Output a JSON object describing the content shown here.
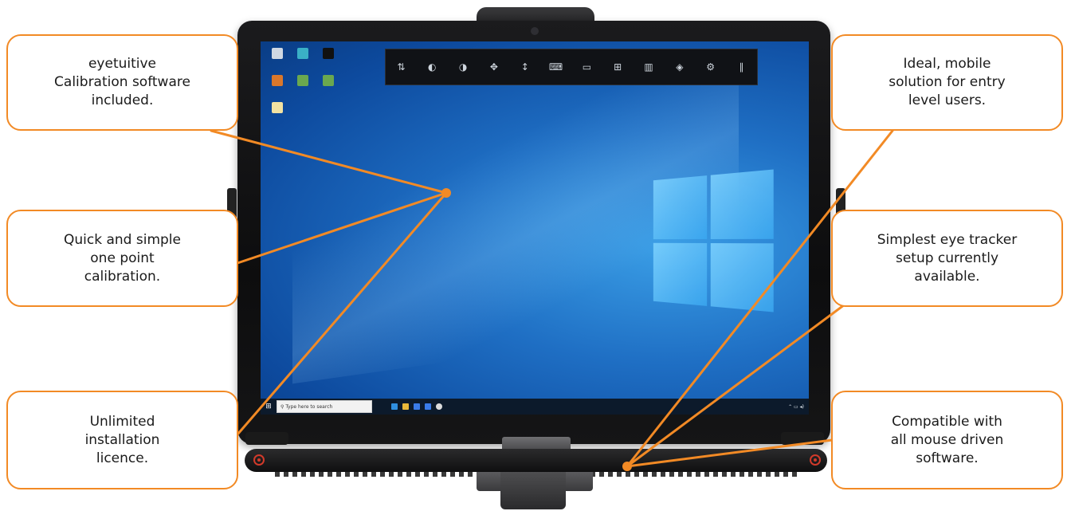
{
  "callouts": {
    "tl": "eyetuitive\nCalibration software\nincluded.",
    "ml": "Quick and simple\none point\ncalibration.",
    "bl": "Unlimited\ninstallation\nlicence.",
    "tr": "Ideal, mobile\nsolution for entry\nlevel users.",
    "mr": "Simplest eye tracker\nsetup currently\navailable.",
    "br": "Compatible with\nall mouse driven\nsoftware."
  },
  "colors": {
    "accent": "#f28a25",
    "text": "#1a1a1a"
  },
  "screen": {
    "toolbar_icons": [
      "swap-vert-icon",
      "left-click-icon",
      "right-click-icon",
      "drag-icon",
      "scroll-icon",
      "keyboard-icon",
      "chat-icon",
      "windows-icon",
      "panel-icon",
      "target-icon",
      "gear-icon",
      "pause-icon"
    ],
    "taskbar": {
      "search_placeholder": "Type here to search"
    }
  }
}
